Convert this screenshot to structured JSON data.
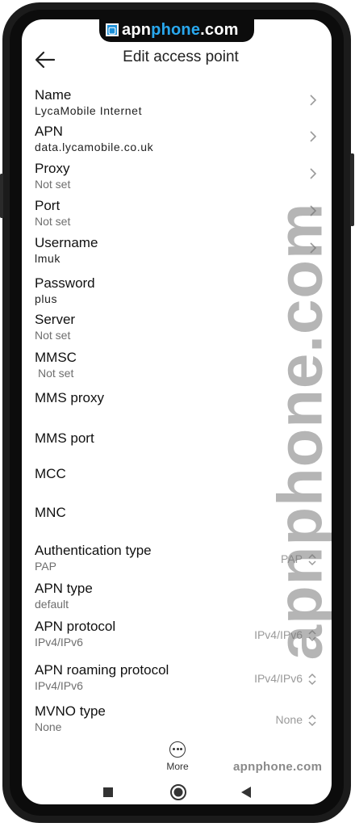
{
  "brand": {
    "domain_top": "apnphone.com",
    "watermark": "apnphone.com",
    "footer": "apnphone.com"
  },
  "header": {
    "title": "Edit access point"
  },
  "fields": [
    {
      "label": "Name",
      "value": "LycaMobile Internet"
    },
    {
      "label": "APN",
      "value": "data.lycamobile.co.uk"
    },
    {
      "label": "Proxy",
      "value": "Not set"
    },
    {
      "label": "Port",
      "value": "Not set"
    },
    {
      "label": "Username",
      "value": "lmuk"
    },
    {
      "label": "Password",
      "value": "plus"
    },
    {
      "label": "Server",
      "value": "Not set"
    },
    {
      "label": "MMSC",
      "value": "Not set"
    },
    {
      "label": "MMS proxy",
      "value": ""
    },
    {
      "label": "MMS port",
      "value": ""
    },
    {
      "label": "MCC",
      "value": ""
    },
    {
      "label": "MNC",
      "value": ""
    },
    {
      "label": "Authentication type",
      "value": "PAP",
      "selected": "PAP"
    },
    {
      "label": "APN type",
      "value": "default"
    },
    {
      "label": "APN protocol",
      "value": "IPv4/IPv6",
      "selected": "IPv4/IPv6"
    },
    {
      "label": "APN roaming protocol",
      "value": "IPv4/IPv6",
      "selected": "IPv4/IPv6"
    },
    {
      "label": "MVNO type",
      "value": "None",
      "selected": "None"
    }
  ],
  "bottom": {
    "more_label": "More"
  },
  "colors": {
    "accent": "#29a8ee",
    "text": "#111111",
    "muted": "#6e6e6e",
    "chevron": "#9a9a9a"
  }
}
